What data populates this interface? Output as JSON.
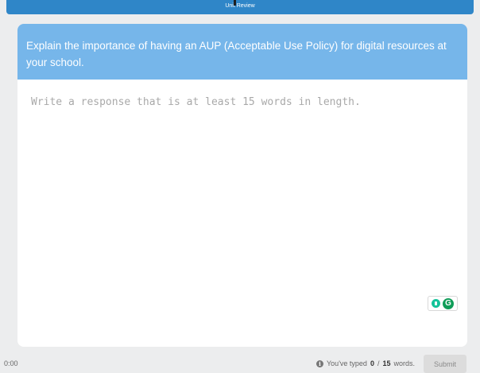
{
  "header": {
    "title": "Unit Review"
  },
  "question": {
    "prompt": "Explain the importance of having an AUP (Acceptable Use Policy) for digital resources at your school."
  },
  "response": {
    "placeholder": "Write a response that is at least 15 words in length.",
    "value": ""
  },
  "footer": {
    "timer": "0:00",
    "status_prefix": "You've typed",
    "typed_count": "0",
    "separator": "/",
    "required_count": "15",
    "status_suffix": "words.",
    "submit_label": "Submit"
  },
  "icons": {
    "info": "info-icon",
    "grammarly_bulb": "lightbulb-icon",
    "grammarly_logo": "grammarly-icon"
  },
  "colors": {
    "header_bar": "#2f86c8",
    "prompt_background": "#76b6ea",
    "grammarly_green": "#15c39a"
  }
}
